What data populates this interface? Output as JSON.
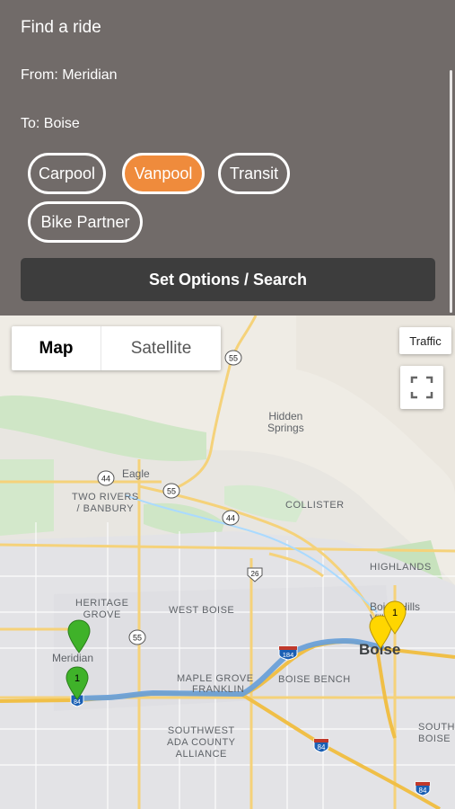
{
  "panel": {
    "title": "Find a ride",
    "from": "From: Meridian",
    "to": "To: Boise",
    "options": [
      {
        "label": "Carpool",
        "active": false
      },
      {
        "label": "Vanpool",
        "active": true
      },
      {
        "label": "Transit",
        "active": false
      },
      {
        "label": "Bike Partner",
        "active": false
      }
    ],
    "search_label": "Set Options / Search",
    "accent_color": "#ef8b3c"
  },
  "map": {
    "type_map": "Map",
    "type_satellite": "Satellite",
    "traffic": "Traffic",
    "labels": {
      "eagle": "Eagle",
      "hidden_springs": "Hidden\nSprings",
      "two_rivers": "TWO RIVERS\n/ BANBURY",
      "collister": "COLLISTER",
      "highlands": "HIGHLANDS",
      "heritage_grove": "HERITAGE\nGROVE",
      "west_boise": "WEST BOISE",
      "meridian": "Meridian",
      "maple_grove": "MAPLE GROVE",
      "franklin": "FRANKLIN",
      "boise_bench": "BOISE BENCH",
      "boise": "Boise",
      "boise_hills_village": "Boise Hills\nVillage",
      "southwest_ada": "SOUTHWEST\nADA COUNTY\nALLIANCE",
      "southeast_boise": "SOUTHEAST\nBOISE"
    },
    "shields": {
      "r55_north": "55",
      "r44_west": "44",
      "r55_eagle": "55",
      "r44_east": "44",
      "r26": "26",
      "r55_south": "55",
      "i184": "184",
      "i84_mid": "84",
      "i84_east": "84",
      "i84_origin": "84"
    },
    "markers": {
      "origin_label": "1",
      "destination_label": "1",
      "origin_color": "#3fb229",
      "destination_color": "#ffd600"
    },
    "route_color": "#6aa0d8"
  }
}
